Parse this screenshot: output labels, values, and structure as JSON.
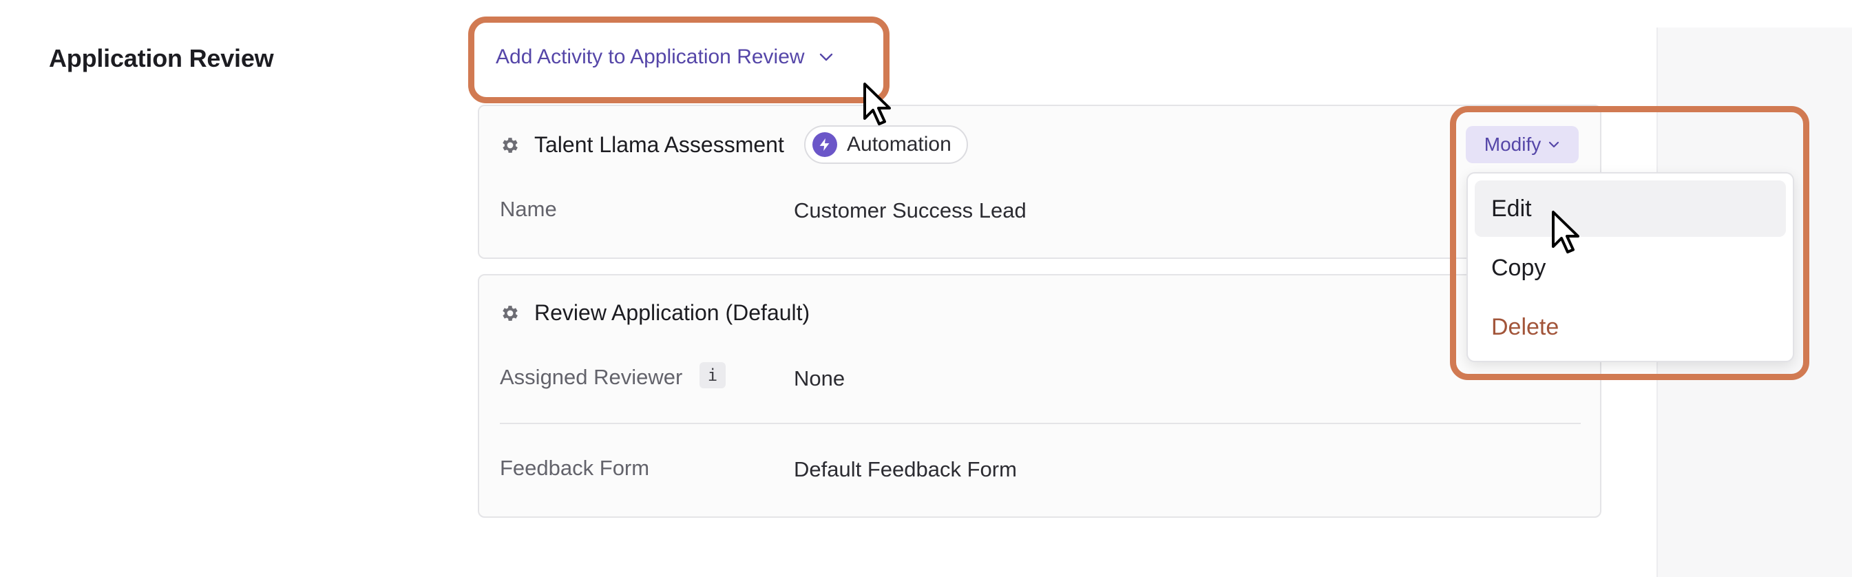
{
  "section": {
    "title": "Application Review"
  },
  "add_activity": {
    "label": "Add Activity to Application Review",
    "icon": "chevron-down-icon"
  },
  "activities": [
    {
      "title": "Talent Llama Assessment",
      "icon": "gear-icon",
      "badge": {
        "label": "Automation",
        "icon": "lightning-bolt-icon"
      },
      "fields": [
        {
          "label": "Name",
          "value": "Customer Success Lead"
        }
      ]
    },
    {
      "title": "Review Application (Default)",
      "icon": "gear-icon",
      "fields": [
        {
          "label": "Assigned Reviewer",
          "info": "i",
          "value": "None"
        },
        {
          "label": "Feedback Form",
          "value": "Default Feedback Form"
        }
      ]
    }
  ],
  "modify": {
    "label": "Modify",
    "menu": [
      {
        "label": "Edit",
        "state": "hover"
      },
      {
        "label": "Copy"
      },
      {
        "label": "Delete",
        "style": "danger"
      }
    ]
  },
  "colors": {
    "accent": "#5546a8",
    "highlight": "#d17a52",
    "danger": "#a2553a",
    "badge_icon": "#6b56c8"
  }
}
